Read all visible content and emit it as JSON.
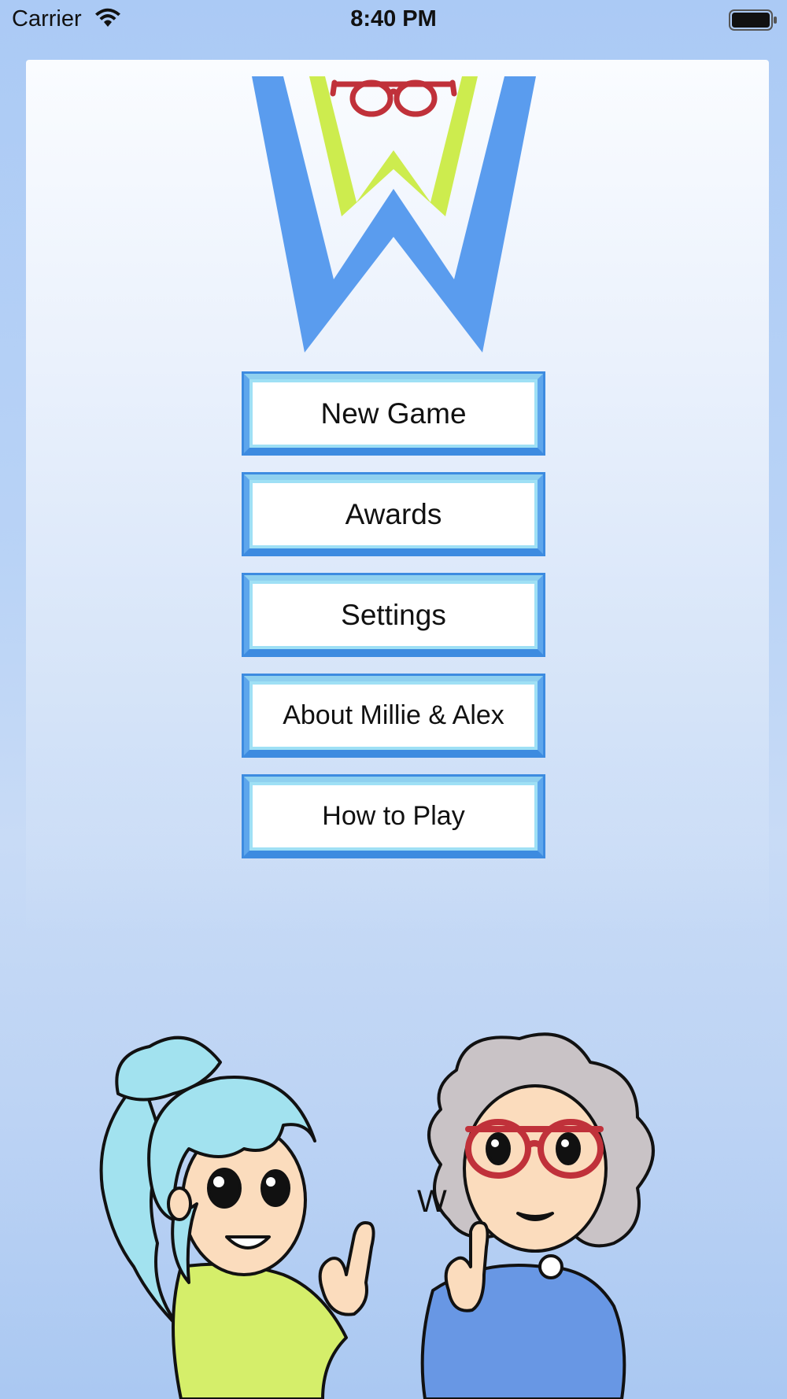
{
  "status_bar": {
    "carrier": "Carrier",
    "time": "8:40 PM",
    "wifi_icon": "wifi-icon",
    "battery_icon": "battery-icon"
  },
  "logo": {
    "letter": "W",
    "icon": "glasses-icon"
  },
  "menu": {
    "new_game": "New Game",
    "awards": "Awards",
    "settings": "Settings",
    "about": "About Millie & Alex",
    "how_to_play": "How to Play"
  },
  "illustration": {
    "sign_letter": "W"
  },
  "colors": {
    "background": "#abcaf5",
    "logo_blue": "#5a9cee",
    "logo_green": "#cdec4e",
    "glasses_red": "#c0313a",
    "button_border": "#5ea6ec",
    "button_highlight": "#9fe0f5",
    "hair_cyan": "#a2e2ef",
    "hair_gray": "#c9c3c6",
    "sweater_green": "#d5ee6a",
    "sweater_blue": "#6897e4",
    "skin": "#fbdcbd"
  }
}
